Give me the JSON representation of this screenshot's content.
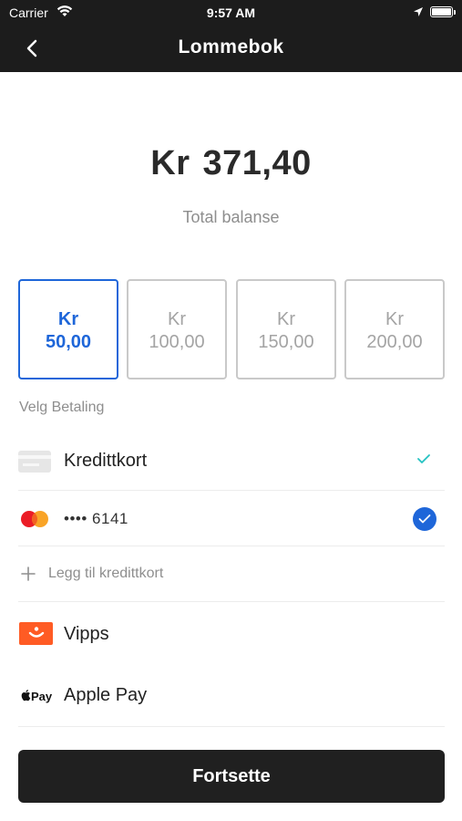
{
  "status_bar": {
    "carrier": "Carrier",
    "time": "9:57 AM",
    "icons": [
      "wifi-icon",
      "location-arrow-icon",
      "battery-icon"
    ]
  },
  "nav": {
    "title": "Lommebok",
    "back_icon": "chevron-left-icon"
  },
  "balance": {
    "currency": "Kr",
    "amount": "371,40",
    "label": "Total balanse"
  },
  "amount_options": [
    {
      "currency": "Kr",
      "value": "50,00",
      "selected": true
    },
    {
      "currency": "Kr",
      "value": "100,00",
      "selected": false
    },
    {
      "currency": "Kr",
      "value": "150,00",
      "selected": false
    },
    {
      "currency": "Kr",
      "value": "200,00",
      "selected": false
    }
  ],
  "payment": {
    "section_label": "Velg Betaling",
    "credit_card": {
      "label": "Kredittkort",
      "icon": "credit-card-icon",
      "status_icon": "check-icon"
    },
    "saved_card": {
      "masked": "•••• 6141",
      "icon": "mastercard-icon",
      "status_icon": "check-circle-icon"
    },
    "add_card": {
      "label": "Legg til kredittkort",
      "icon": "plus-icon"
    },
    "vipps": {
      "label": "Vipps",
      "icon": "vipps-icon"
    },
    "apple_pay": {
      "label": "Apple Pay",
      "icon": "apple-pay-icon",
      "icon_text": "Pay"
    }
  },
  "continue_button": {
    "label": "Fortsette"
  },
  "colors": {
    "header": "#1c1c1c",
    "accent": "#1e66d9",
    "check_teal": "#24c2c2",
    "vipps": "#ff5b24",
    "button": "#202020"
  }
}
